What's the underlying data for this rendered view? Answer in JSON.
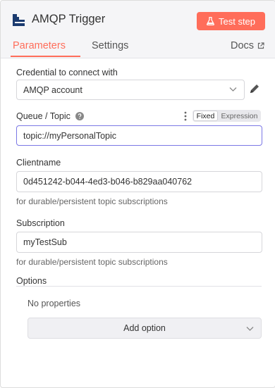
{
  "header": {
    "title": "AMQP Trigger",
    "test_step_label": "Test step",
    "node_icon": "amqp-node-icon",
    "accent": "#ff6d5a"
  },
  "tabs": [
    {
      "label": "Parameters",
      "active": true
    },
    {
      "label": "Settings",
      "active": false
    }
  ],
  "docs": {
    "label": "Docs",
    "icon": "external-link-icon"
  },
  "credential": {
    "label": "Credential to connect with",
    "value": "AMQP account"
  },
  "queue": {
    "label": "Queue / Topic",
    "value": "topic://myPersonalTopic",
    "mode_fixed": "Fixed",
    "mode_expression": "Expression",
    "focus_color": "#7b78e5"
  },
  "clientname": {
    "label": "Clientname",
    "value": "0d451242-b044-4ed3-b046-b829aa040762",
    "hint": "for durable/persistent topic subscriptions"
  },
  "subscription": {
    "label": "Subscription",
    "value": "myTestSub",
    "hint": "for durable/persistent topic subscriptions"
  },
  "options": {
    "label": "Options",
    "empty_text": "No properties",
    "add_label": "Add option"
  }
}
